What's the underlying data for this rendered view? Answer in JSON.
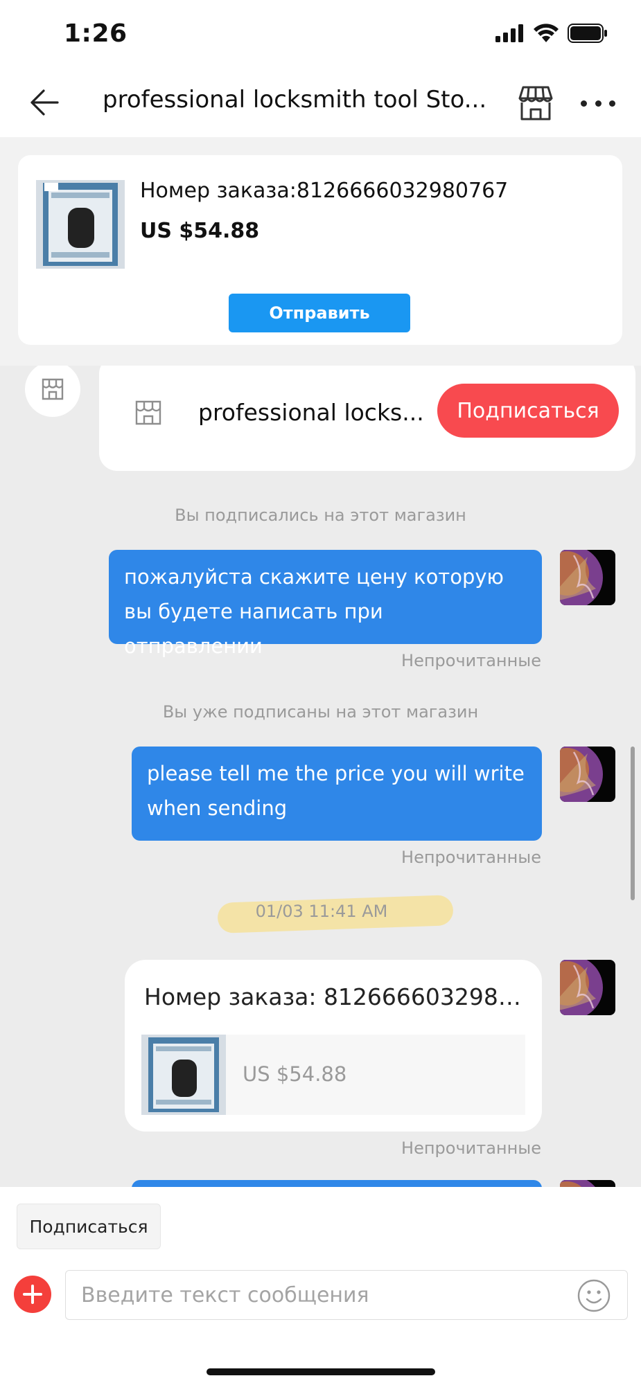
{
  "status_bar": {
    "time": "1:26"
  },
  "nav": {
    "title": "professional locksmith tool Sto..."
  },
  "order_panel": {
    "order_number": "Номер заказа:8126666032980767",
    "price": "US $54.88",
    "send_label": "Отправить"
  },
  "store_card": {
    "name": "professional locks...",
    "subscribe_label": "Подписаться"
  },
  "messages": [
    {
      "system_note": "Вы подписались на этот магазин",
      "text": "пожалуйста скажите цену которую вы будете написать при отправлении",
      "status": "Непрочитанные"
    },
    {
      "system_note": "Вы уже подписаны на этот магазин",
      "text": "please tell me the price you will write when sending",
      "status": "Непрочитанные"
    }
  ],
  "timestamp": "01/03 11:41 AM",
  "order_message": {
    "order_number": "Номер заказа: 81266660329807...",
    "price": "US $54.88",
    "status": "Непрочитанные"
  },
  "bottom": {
    "quick_reply": "Подписаться",
    "input_placeholder": "Введите текст сообщения"
  },
  "icons": {
    "back": "arrow-left-icon",
    "store": "store-icon",
    "more": "more-dots-icon",
    "add": "plus-icon",
    "emoji": "smiley-icon"
  },
  "colors": {
    "accent_blue": "#1a97f2",
    "bubble_blue": "#2f87e8",
    "subscribe_red": "#f84a4f",
    "add_red": "#f43f3b"
  }
}
